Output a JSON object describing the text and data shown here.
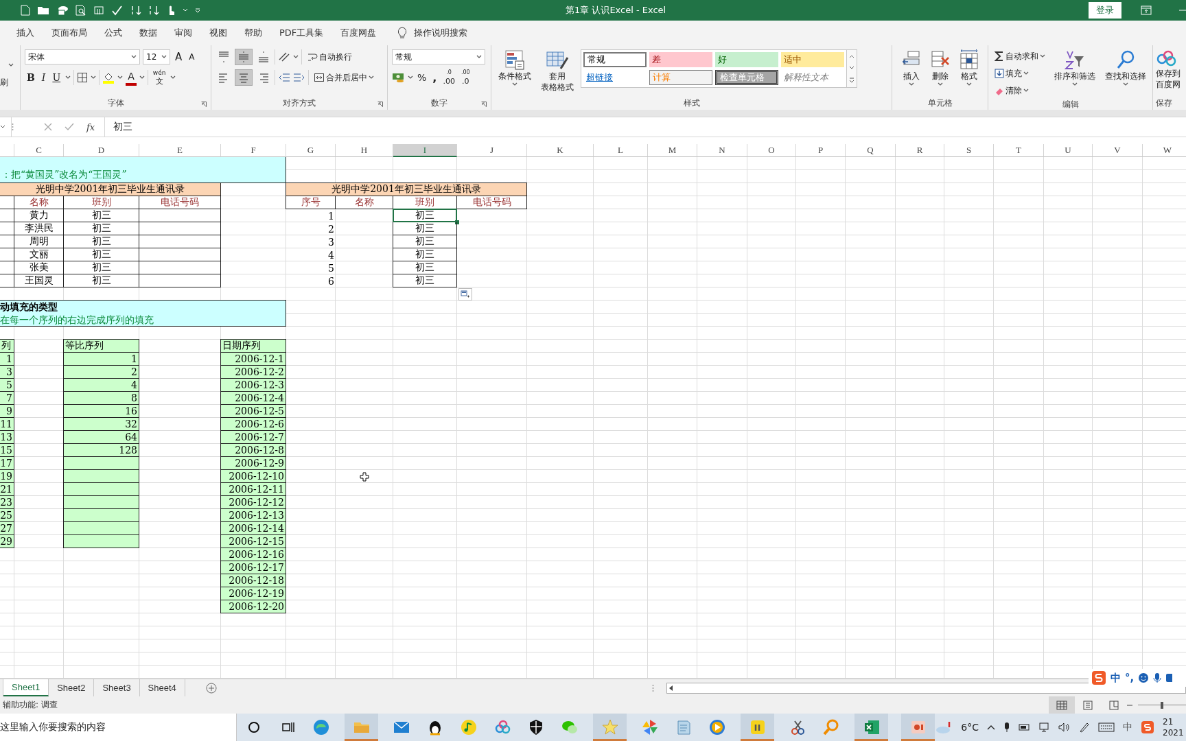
{
  "title_bar": {
    "title": "第1章  认识Excel  -  Excel",
    "login": "登录"
  },
  "menu_tabs": [
    "插入",
    "页面布局",
    "公式",
    "数据",
    "审阅",
    "视图",
    "帮助",
    "PDF工具集",
    "百度网盘"
  ],
  "tell_me": "操作说明搜索",
  "ribbon": {
    "clipboard": {
      "label": "刷"
    },
    "font": {
      "name": "宋体",
      "size": "12",
      "grow": "A",
      "shrink": "A",
      "bold": "B",
      "italic": "I",
      "underline": "U",
      "font_color": "A",
      "phonetic_top": "wén",
      "phonetic_bottom": "文",
      "label": "字体"
    },
    "alignment": {
      "vertical": [
        {
          "kind": "top",
          "selected": false
        },
        {
          "kind": "middle",
          "selected": true
        },
        {
          "kind": "bottom",
          "selected": false
        }
      ],
      "horizontal": [
        {
          "kind": "left",
          "selected": false
        },
        {
          "kind": "center",
          "selected": true
        },
        {
          "kind": "right",
          "selected": false
        }
      ],
      "wrap": "自动换行",
      "merge": "合并后居中",
      "label": "对齐方式"
    },
    "number": {
      "format": "常规",
      "percent": "%",
      "comma": ",",
      "decimals": [
        {
          "top": ".0",
          "bottom": ".00"
        },
        {
          "top": ".00",
          "bottom": ".0"
        }
      ],
      "label": "数字"
    },
    "styles": {
      "conditional": "条件格式",
      "table_format": [
        "套用",
        "表格格式"
      ],
      "cell_styles": [
        {
          "label": "常规",
          "kind": "normal"
        },
        {
          "label": "差",
          "kind": "bad"
        },
        {
          "label": "好",
          "kind": "good"
        },
        {
          "label": "适中",
          "kind": "neutral"
        },
        {
          "label": "超链接",
          "kind": "hyperlink"
        },
        {
          "label": "计算",
          "kind": "calc"
        },
        {
          "label": "检查单元格",
          "kind": "check"
        },
        {
          "label": "解释性文本",
          "kind": "explanatory"
        }
      ],
      "label": "样式"
    },
    "cells": {
      "buttons": [
        "插入",
        "删除",
        "格式"
      ],
      "label": "单元格"
    },
    "editing": {
      "autosum": "自动求和",
      "fill": "填充",
      "clear": "清除",
      "sort": "排序和筛选",
      "find": "查找和选择",
      "label": "编辑"
    },
    "baidu": {
      "lines": [
        "保存到",
        "百度网"
      ],
      "label": "保存"
    }
  },
  "formula_bar": {
    "fx": "fx",
    "value": "初三"
  },
  "columns": [
    {
      "label": "C",
      "selected": false
    },
    {
      "label": "D",
      "selected": false
    },
    {
      "label": "E",
      "selected": false
    },
    {
      "label": "F",
      "selected": false
    },
    {
      "label": "G",
      "selected": false
    },
    {
      "label": "H",
      "selected": false
    },
    {
      "label": "I",
      "selected": true
    },
    {
      "label": "J",
      "selected": false
    },
    {
      "label": "K",
      "selected": false
    },
    {
      "label": "L",
      "selected": false
    },
    {
      "label": "M",
      "selected": false
    },
    {
      "label": "N",
      "selected": false
    },
    {
      "label": "O",
      "selected": false
    },
    {
      "label": "P",
      "selected": false
    },
    {
      "label": "Q",
      "selected": false
    },
    {
      "label": "R",
      "selected": false
    },
    {
      "label": "S",
      "selected": false
    },
    {
      "label": "T",
      "selected": false
    },
    {
      "label": "U",
      "selected": false
    },
    {
      "label": "V",
      "selected": false
    },
    {
      "label": "W",
      "selected": false
    }
  ],
  "sheet": {
    "note_top": "：把“黄国灵”改名为“王国灵”",
    "table1": {
      "title": "光明中学2001年初三毕业生通讯录",
      "headers": [
        "名称",
        "班别",
        "电话号码"
      ],
      "rows": [
        {
          "name": "黄力",
          "class": "初三"
        },
        {
          "name": "李洪民",
          "class": "初三"
        },
        {
          "name": "周明",
          "class": "初三"
        },
        {
          "name": "文丽",
          "class": "初三"
        },
        {
          "name": "张美",
          "class": "初三"
        },
        {
          "name": "王国灵",
          "class": "初三"
        }
      ]
    },
    "table2": {
      "title": "光明中学2001年初三毕业生通讯录",
      "headers": [
        "序号",
        "名称",
        "班别",
        "电话号码"
      ],
      "rows": [
        {
          "index": "1",
          "class": "初三",
          "selected": true
        },
        {
          "index": "2",
          "class": "初三",
          "selected": false
        },
        {
          "index": "3",
          "class": "初三",
          "selected": false
        },
        {
          "index": "4",
          "class": "初三",
          "selected": false
        },
        {
          "index": "5",
          "class": "初三",
          "selected": false
        },
        {
          "index": "6",
          "class": "初三",
          "selected": false
        }
      ]
    },
    "fill_note": {
      "heading": "动填充的类型",
      "text": "在每一个序列的右边完成序列的填充"
    },
    "fill_series": [
      {
        "header": "列",
        "values": [
          "1",
          "3",
          "5",
          "7",
          "9",
          "11",
          "13",
          "15",
          "17",
          "19",
          "21",
          "23",
          "25",
          "27",
          "29"
        ]
      },
      {
        "header": "等比序列",
        "values": [
          "1",
          "2",
          "4",
          "8",
          "16",
          "32",
          "64",
          "128"
        ]
      },
      {
        "header": "日期序列",
        "values": [
          "2006-12-1",
          "2006-12-2",
          "2006-12-3",
          "2006-12-4",
          "2006-12-5",
          "2006-12-6",
          "2006-12-7",
          "2006-12-8",
          "2006-12-9",
          "2006-12-10",
          "2006-12-11",
          "2006-12-12",
          "2006-12-13",
          "2006-12-14",
          "2006-12-15",
          "2006-12-16",
          "2006-12-17",
          "2006-12-18",
          "2006-12-19",
          "2006-12-20"
        ]
      }
    ]
  },
  "sheet_tabs": [
    {
      "label": "Sheet1",
      "selected": true
    },
    {
      "label": "Sheet2",
      "selected": false
    },
    {
      "label": "Sheet3",
      "selected": false
    },
    {
      "label": "Sheet4",
      "selected": false
    }
  ],
  "status_bar": {
    "text": "辅助功能: 调查",
    "zoom": {
      "level": 0.5
    }
  },
  "ime_bar": {
    "mode": "中",
    "punct": "°,"
  },
  "taskbar": {
    "search_placeholder": "这里输入你要搜索的内容",
    "weather": "6°C",
    "tray_ime": "中",
    "clock_time": "21",
    "clock_date": "2021"
  }
}
